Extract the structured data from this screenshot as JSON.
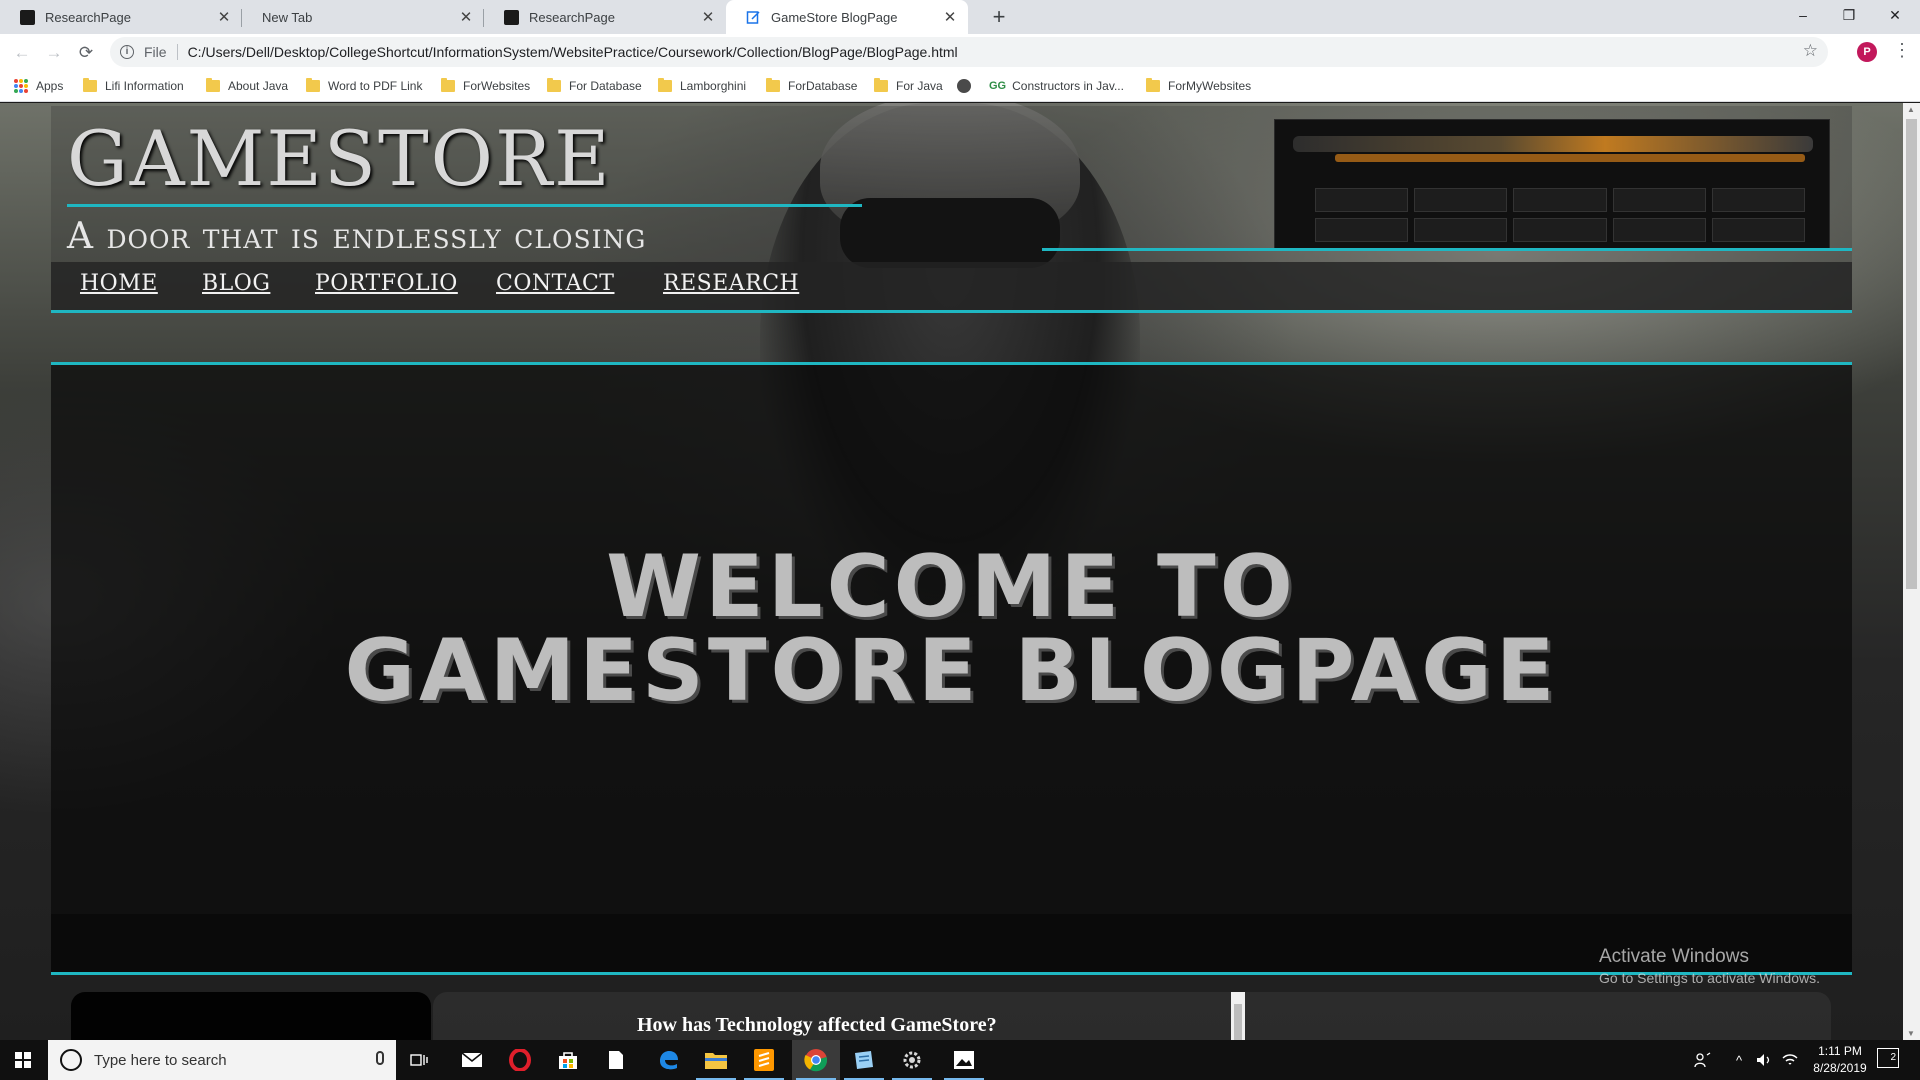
{
  "browser": {
    "tabs": [
      {
        "title": "ResearchPage",
        "favicon": "dark-square-icon"
      },
      {
        "title": "New Tab",
        "favicon": "none"
      },
      {
        "title": "ResearchPage",
        "favicon": "dark-square-icon"
      },
      {
        "title": "GameStore BlogPage",
        "favicon": "page-icon",
        "active": true
      }
    ],
    "new_tab_symbol": "+",
    "window_controls": {
      "minimize": "–",
      "restore": "❐",
      "close": "✕"
    },
    "nav": {
      "back": "←",
      "forward": "→",
      "reload": "⟳"
    },
    "address": {
      "scheme_label": "File",
      "url": "C:/Users/Dell/Desktop/CollegeShortcut/InformationSystem/WebsitePractice/Coursework/Collection/BlogPage/BlogPage.html",
      "bookmark_star": "☆"
    },
    "profile_initial": "P",
    "menu_symbol": "⋮",
    "bookmarks": [
      {
        "label": "Apps",
        "icon": "apps-grid-icon"
      },
      {
        "label": "Lifi Information",
        "icon": "folder-icon"
      },
      {
        "label": "About Java",
        "icon": "folder-icon"
      },
      {
        "label": "Word to PDF Link",
        "icon": "folder-icon"
      },
      {
        "label": "ForWebsites",
        "icon": "folder-icon"
      },
      {
        "label": "For Database",
        "icon": "folder-icon"
      },
      {
        "label": "Lamborghini",
        "icon": "folder-icon"
      },
      {
        "label": "ForDatabase",
        "icon": "folder-icon"
      },
      {
        "label": "For Java",
        "icon": "folder-icon"
      },
      {
        "label": "",
        "icon": "globe-icon"
      },
      {
        "label": "Constructors in Jav...",
        "icon": "gfg-icon",
        "prefix": "GG"
      },
      {
        "label": "ForMyWebsites",
        "icon": "folder-icon"
      }
    ]
  },
  "page": {
    "site_title": "GAMESTORE",
    "tagline": "A door that is endlessly closing",
    "nav_links": [
      "HOME",
      "BLOG",
      "PORTFOLIO",
      "CONTACT",
      "RESEARCH"
    ],
    "hero_line1": "WELCOME TO",
    "hero_line2": "GAMESTORE BLOGPAGE",
    "article_heading": "How has Technology affected GameStore?",
    "accent_color": "#1fb7c2"
  },
  "watermark": {
    "line1": "Activate Windows",
    "line2": "Go to Settings to activate Windows."
  },
  "taskbar": {
    "search_placeholder": "Type here to search",
    "time": "1:11 PM",
    "date": "8/28/2019",
    "notification_count": "2",
    "pinned_icons": [
      "task-view-icon",
      "mail-icon",
      "opera-icon",
      "store-icon",
      "file-icon",
      "edge-icon",
      "file-explorer-icon",
      "sublime-text-icon",
      "chrome-icon",
      "notepad-icon",
      "settings-icon",
      "photos-icon"
    ]
  }
}
